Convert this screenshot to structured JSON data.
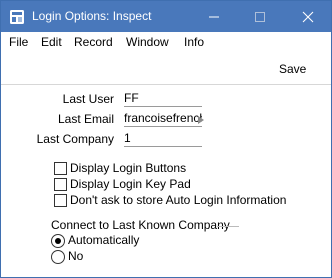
{
  "window": {
    "title": "Login Options: Inspect",
    "titlebar_color": "#4978bb",
    "icons": [
      "app-icon",
      "minimize-icon",
      "maximize-icon",
      "close-icon"
    ]
  },
  "menu": {
    "items": [
      "File",
      "Edit",
      "Record",
      "Window",
      "Info"
    ]
  },
  "toolbar": {
    "save_label": "Save"
  },
  "fields": {
    "last_user": {
      "label": "Last User",
      "value": "FF"
    },
    "last_email": {
      "label": "Last Email",
      "value": "francoisefrench@"
    },
    "last_company": {
      "label": "Last Company",
      "value": "1"
    }
  },
  "options": [
    {
      "label": "Display Login Buttons",
      "checked": false
    },
    {
      "label": "Display Login Key Pad",
      "checked": false
    },
    {
      "label": "Don't ask to store Auto Login Information",
      "checked": false
    }
  ],
  "connect_group": {
    "title": "Connect to Last Known Company",
    "choices": [
      {
        "label": "Automatically",
        "selected": true
      },
      {
        "label": "No",
        "selected": false
      }
    ]
  }
}
